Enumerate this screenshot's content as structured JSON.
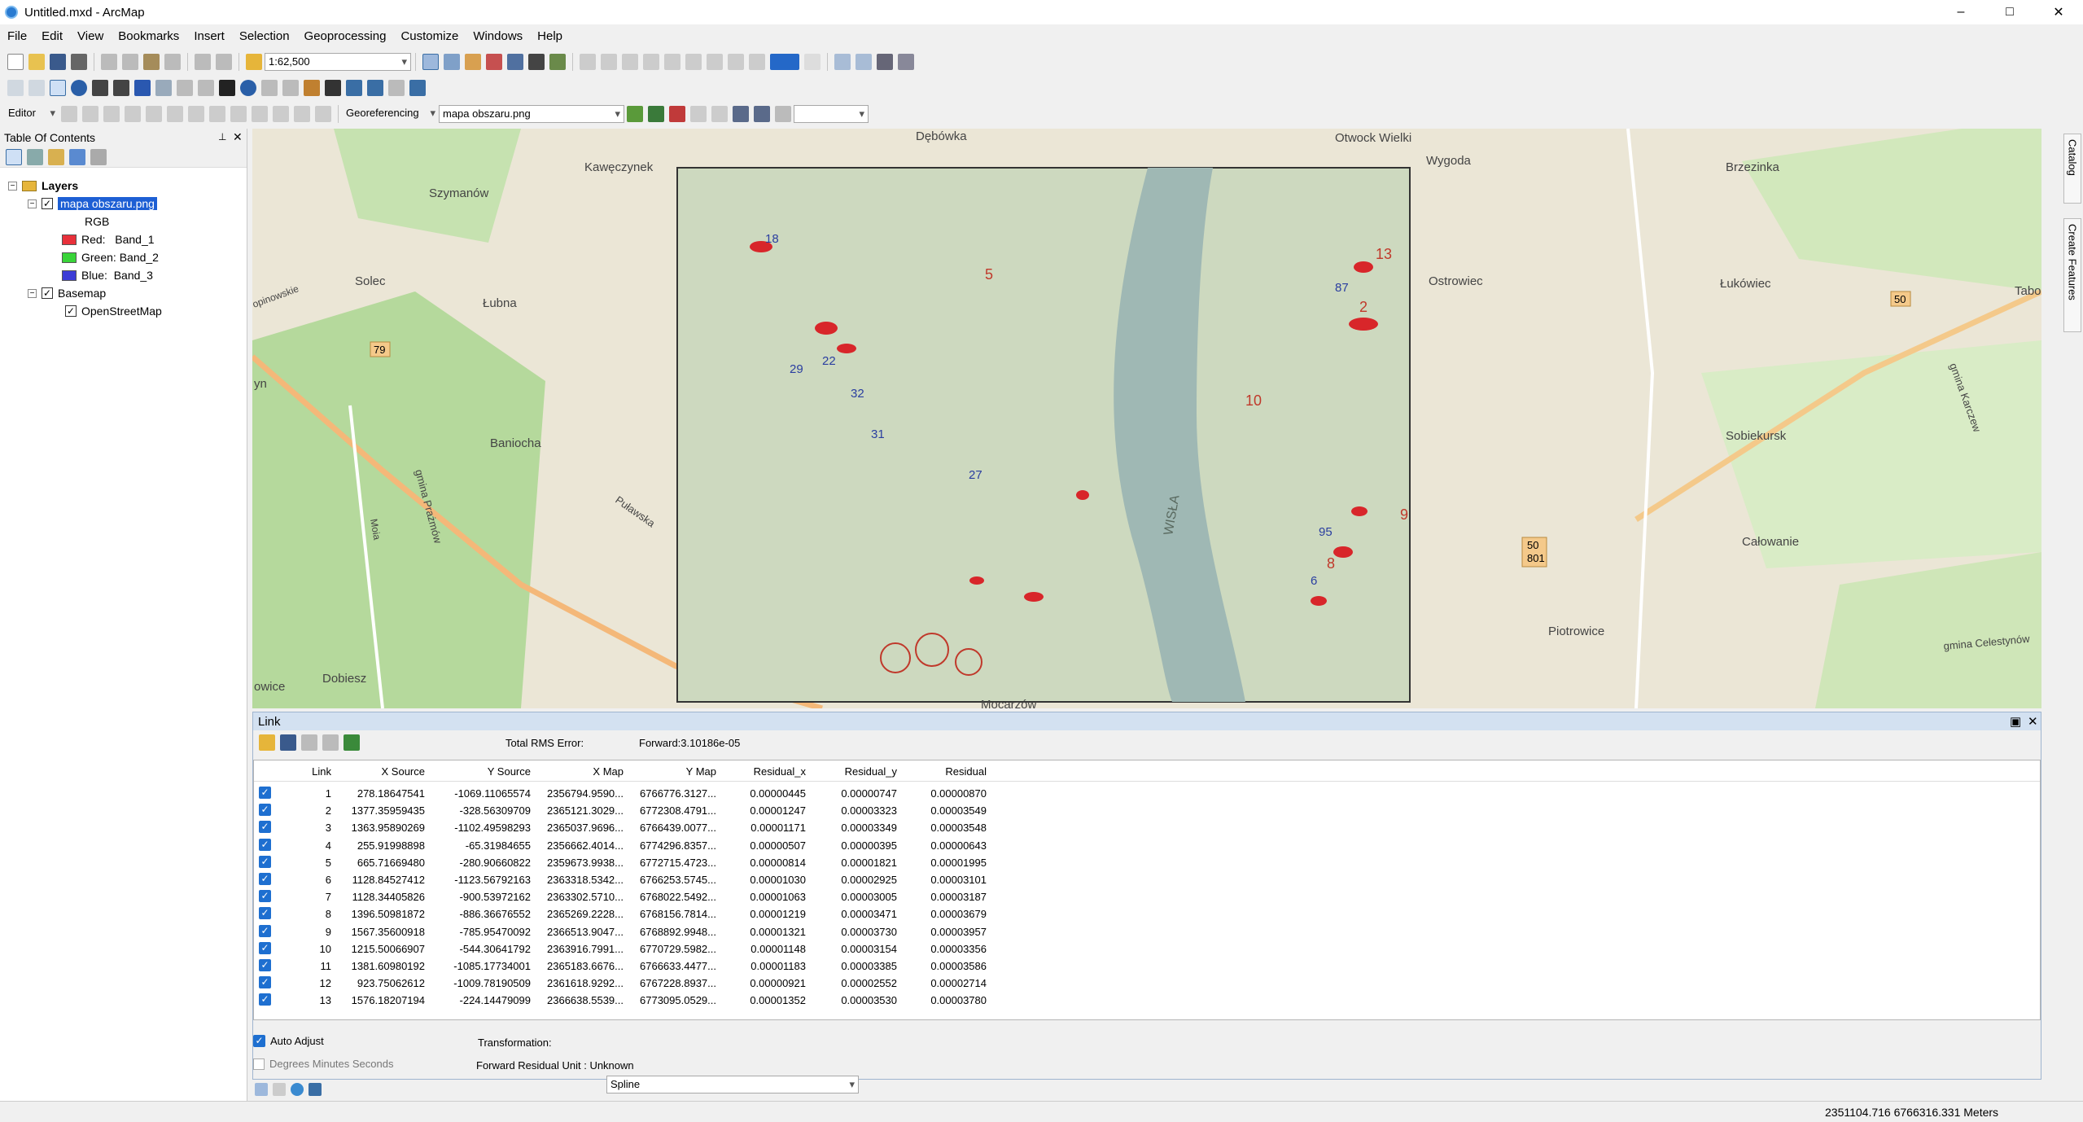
{
  "window": {
    "title": "Untitled.mxd - ArcMap",
    "minimize": "–",
    "maximize": "□",
    "close": "✕"
  },
  "menu": [
    "File",
    "Edit",
    "View",
    "Bookmarks",
    "Insert",
    "Selection",
    "Geoprocessing",
    "Customize",
    "Windows",
    "Help"
  ],
  "toolbar": {
    "scale": "1:62,500",
    "editor_label": "Editor",
    "georef_label": "Georeferencing",
    "georef_layer": "mapa obszaru.png"
  },
  "toc": {
    "title": "Table Of Contents",
    "layers_label": "Layers",
    "raster_layer": "mapa obszaru.png",
    "rgb_label": "RGB",
    "bands": [
      {
        "label": "Red:   Band_1",
        "color": "#e8303a"
      },
      {
        "label": "Green: Band_2",
        "color": "#39d439"
      },
      {
        "label": "Blue:  Band_3",
        "color": "#3b3bd6"
      }
    ],
    "basemap_label": "Basemap",
    "osm_label": "OpenStreetMap"
  },
  "map": {
    "places": [
      "Dębówka",
      "Otwock Wielki",
      "Wygoda",
      "Brzezinka",
      "Kawęczynek",
      "Szymanów",
      "Ostrowiec",
      "Łukówiec",
      "Solec",
      "Łubna",
      "Tabor",
      "Sobiekursk",
      "Baniocha",
      "gmina Karczew",
      "Całowanie",
      "Piotrowice",
      "gmina Prażmów",
      "Puławska",
      "Dobiesz",
      "gmina Celestynów",
      "owice",
      "opinowskie",
      "Mocarzów",
      "Moia"
    ],
    "road_numbers": [
      "79",
      "50",
      "50\n801",
      "50",
      "yn"
    ],
    "river_label": "WISŁA"
  },
  "link": {
    "title": "Link",
    "rms_label": "Total RMS Error:",
    "rms_value": "Forward:3.10186e-05",
    "columns": [
      "Link",
      "X Source",
      "Y Source",
      "X Map",
      "Y Map",
      "Residual_x",
      "Residual_y",
      "Residual"
    ],
    "rows": [
      [
        "1",
        "278.18647541",
        "-1069.11065574",
        "2356794.9590...",
        "6766776.3127...",
        "0.00000445",
        "0.00000747",
        "0.00000870"
      ],
      [
        "2",
        "1377.35959435",
        "-328.56309709",
        "2365121.3029...",
        "6772308.4791...",
        "0.00001247",
        "0.00003323",
        "0.00003549"
      ],
      [
        "3",
        "1363.95890269",
        "-1102.49598293",
        "2365037.9696...",
        "6766439.0077...",
        "0.00001171",
        "0.00003349",
        "0.00003548"
      ],
      [
        "4",
        "255.91998898",
        "-65.31984655",
        "2356662.4014...",
        "6774296.8357...",
        "0.00000507",
        "0.00000395",
        "0.00000643"
      ],
      [
        "5",
        "665.71669480",
        "-280.90660822",
        "2359673.9938...",
        "6772715.4723...",
        "0.00000814",
        "0.00001821",
        "0.00001995"
      ],
      [
        "6",
        "1128.84527412",
        "-1123.56792163",
        "2363318.5342...",
        "6766253.5745...",
        "0.00001030",
        "0.00002925",
        "0.00003101"
      ],
      [
        "7",
        "1128.34405826",
        "-900.53972162",
        "2363302.5710...",
        "6768022.5492...",
        "0.00001063",
        "0.00003005",
        "0.00003187"
      ],
      [
        "8",
        "1396.50981872",
        "-886.36676552",
        "2365269.2228...",
        "6768156.7814...",
        "0.00001219",
        "0.00003471",
        "0.00003679"
      ],
      [
        "9",
        "1567.35600918",
        "-785.95470092",
        "2366513.9047...",
        "6768892.9948...",
        "0.00001321",
        "0.00003730",
        "0.00003957"
      ],
      [
        "10",
        "1215.50066907",
        "-544.30641792",
        "2363916.7991...",
        "6770729.5982...",
        "0.00001148",
        "0.00003154",
        "0.00003356"
      ],
      [
        "11",
        "1381.60980192",
        "-1085.17734001",
        "2365183.6676...",
        "6766633.4477...",
        "0.00001183",
        "0.00003385",
        "0.00003586"
      ],
      [
        "12",
        "923.75062612",
        "-1009.78190509",
        "2361618.9292...",
        "6767228.8937...",
        "0.00000921",
        "0.00002552",
        "0.00002714"
      ],
      [
        "13",
        "1576.18207194",
        "-224.14479099",
        "2366638.5539...",
        "6773095.0529...",
        "0.00001352",
        "0.00003530",
        "0.00003780"
      ]
    ],
    "auto_adjust": "Auto Adjust",
    "dms": "Degrees Minutes Seconds",
    "transformation_label": "Transformation:",
    "transformation_value": "Spline",
    "residual_unit": "Forward Residual Unit : Unknown"
  },
  "status": {
    "coords": "2351104.716  6766316.331 Meters"
  },
  "side_tabs": [
    "Catalog",
    "Create Features"
  ]
}
